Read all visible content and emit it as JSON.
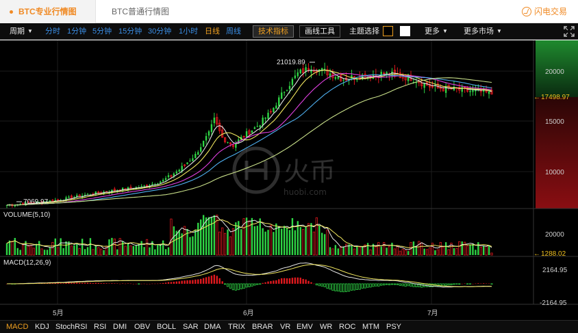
{
  "tabs": {
    "active": "BTC专业行情图",
    "normal": "BTC普通行情图"
  },
  "brand": {
    "label": "闪电交易"
  },
  "toolbar": {
    "period": "周期",
    "intervals": [
      "分时",
      "1分钟",
      "5分钟",
      "15分钟",
      "30分钟",
      "1小时",
      "日线",
      "周线"
    ],
    "selected_interval": "日线",
    "tech_indicator": "技术指标",
    "drawing_tools": "画线工具",
    "theme_select": "主题选择",
    "more": "更多",
    "more_markets": "更多市场"
  },
  "price_panel": {
    "high_label": "21019.89",
    "low_label": "7069.97",
    "current_price": "17498.97",
    "axis_ticks": [
      "20000",
      "15000",
      "10000"
    ]
  },
  "volume_panel": {
    "label": "VOLUME(5,10)",
    "axis_tick": "20000",
    "current_volume": "1288.02"
  },
  "macd_panel": {
    "label": "MACD(12,26,9)",
    "axis_ticks": [
      "2164.95",
      "-2164.95"
    ]
  },
  "time_axis": [
    "5月",
    "6月",
    "7月"
  ],
  "watermark": {
    "brand": "火币",
    "domain": "huobi.com"
  },
  "indicators": [
    "MACD",
    "KDJ",
    "StochRSI",
    "RSI",
    "DMI",
    "OBV",
    "BOLL",
    "SAR",
    "DMA",
    "TRIX",
    "BRAR",
    "VR",
    "EMV",
    "WR",
    "ROC",
    "MTM",
    "PSY"
  ],
  "active_indicator": "MACD",
  "colors": {
    "up": "#2fd545",
    "down": "#e0191e",
    "accent": "#f08a24",
    "ma5": "#e6e6e6",
    "ma10": "#f2e860",
    "ma20": "#e040e0",
    "ma30": "#4fb0f0",
    "ma60": "#c9e08a"
  }
}
